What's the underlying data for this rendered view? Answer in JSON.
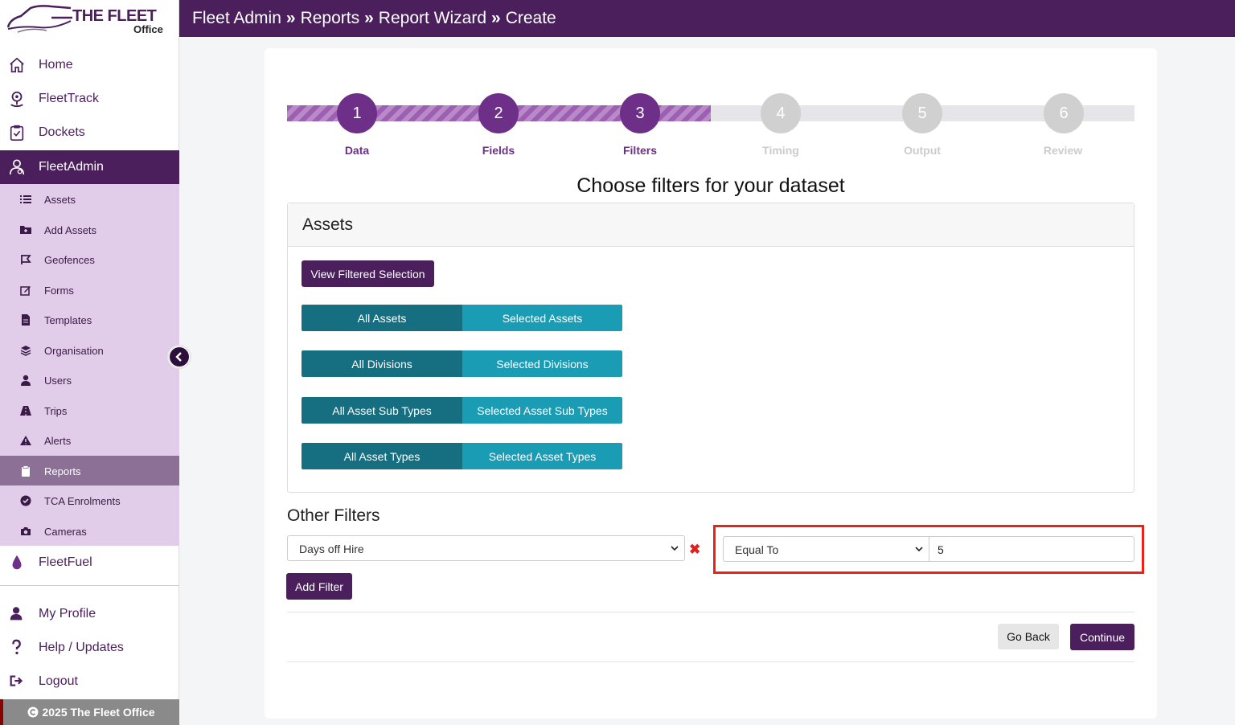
{
  "brand": {
    "line1": "THE FLEET",
    "line2": "Office"
  },
  "header": {
    "crumbs": [
      "Fleet Admin",
      "Reports",
      "Report Wizard",
      "Create"
    ],
    "separator": "»"
  },
  "sidebar": {
    "main": [
      {
        "label": "Home",
        "icon": "home-icon"
      },
      {
        "label": "FleetTrack",
        "icon": "map-pin-icon"
      },
      {
        "label": "Dockets",
        "icon": "clipboard-check-icon"
      },
      {
        "label": "FleetAdmin",
        "icon": "admin-user-icon"
      }
    ],
    "sub": [
      {
        "label": "Assets",
        "icon": "list-icon"
      },
      {
        "label": "Add Assets",
        "icon": "folder-plus-icon"
      },
      {
        "label": "Geofences",
        "icon": "geofence-icon"
      },
      {
        "label": "Forms",
        "icon": "edit-icon"
      },
      {
        "label": "Templates",
        "icon": "file-icon"
      },
      {
        "label": "Organisation",
        "icon": "layers-icon"
      },
      {
        "label": "Users",
        "icon": "user-icon"
      },
      {
        "label": "Trips",
        "icon": "road-icon"
      },
      {
        "label": "Alerts",
        "icon": "warning-icon"
      },
      {
        "label": "Reports",
        "icon": "clipboard-icon"
      },
      {
        "label": "TCA Enrolments",
        "icon": "check-circle-icon"
      },
      {
        "label": "Cameras",
        "icon": "camera-icon"
      }
    ],
    "fuel": {
      "label": "FleetFuel",
      "icon": "drop-icon"
    },
    "bottom": [
      {
        "label": "My Profile",
        "icon": "user-icon"
      },
      {
        "label": "Help / Updates",
        "icon": "question-icon"
      },
      {
        "label": "Logout",
        "icon": "logout-icon"
      }
    ],
    "footer": "2025 The Fleet Office"
  },
  "wizard": {
    "steps": [
      {
        "num": "1",
        "label": "Data"
      },
      {
        "num": "2",
        "label": "Fields"
      },
      {
        "num": "3",
        "label": "Filters"
      },
      {
        "num": "4",
        "label": "Timing"
      },
      {
        "num": "5",
        "label": "Output"
      },
      {
        "num": "6",
        "label": "Review"
      }
    ],
    "current_step": 3,
    "heading": "Choose filters for your dataset"
  },
  "assets_panel": {
    "title": "Assets",
    "view_button": "View Filtered Selection",
    "toggles": [
      {
        "all": "All Assets",
        "selected": "Selected Assets"
      },
      {
        "all": "All Divisions",
        "selected": "Selected Divisions"
      },
      {
        "all": "All Asset Sub Types",
        "selected": "Selected Asset Sub Types"
      },
      {
        "all": "All Asset Types",
        "selected": "Selected Asset Types"
      }
    ]
  },
  "other_filters": {
    "title": "Other Filters",
    "field_select": "Days off Hire",
    "operator_select": "Equal To",
    "value": "5",
    "add_button": "Add Filter"
  },
  "actions": {
    "back": "Go Back",
    "continue": "Continue"
  },
  "colors": {
    "brand_purple": "#4a1f5c",
    "step_purple": "#6e2f88",
    "teal_dark": "#156f80",
    "teal": "#1a9cb5",
    "highlight_red": "#e8231a"
  }
}
